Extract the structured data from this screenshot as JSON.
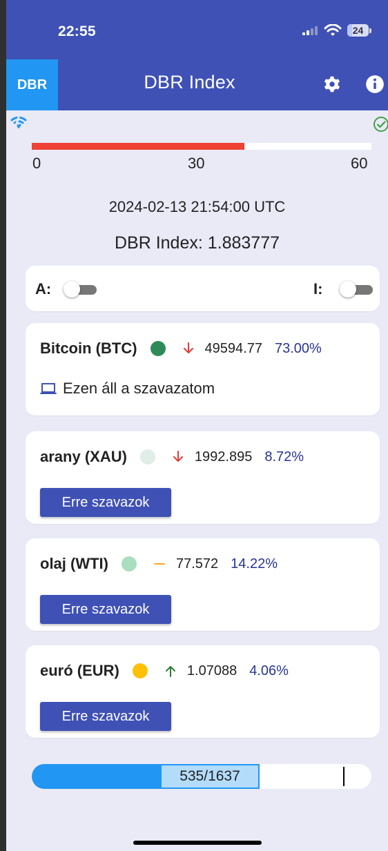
{
  "status_bar": {
    "time": "22:55",
    "battery": "24",
    "battery_fraction": 0.24
  },
  "app_bar": {
    "logo": "DBR",
    "title": "DBR Index",
    "settings_icon": "gear-icon",
    "info_icon": "info-icon"
  },
  "timer": {
    "wifi_icon": "wifi-icon",
    "status_icon": "check-circle-icon",
    "progress_fraction": 0.625,
    "ticks": [
      "0",
      "30",
      "60"
    ]
  },
  "summary": {
    "timestamp": "2024-02-13 21:54:00 UTC",
    "index": "DBR Index: 1.883777"
  },
  "toggles": {
    "a_label": "A:",
    "i_label": "I:",
    "a_on": false,
    "i_on": false
  },
  "assets": [
    {
      "name": "Bitcoin (BTC)",
      "dot_color": "#2e8b57",
      "trend": "down",
      "trend_color": "#e53935",
      "value": "49594.77",
      "percent": "73.00%",
      "vote_status": "Ezen áll a szavazatom",
      "vote_icon": "laptop-icon"
    },
    {
      "name": "arany (XAU)",
      "dot_color": "#dfeee6",
      "trend": "down",
      "trend_color": "#e53935",
      "value": "1992.895",
      "percent": "8.72%",
      "button": "Erre szavazok"
    },
    {
      "name": "olaj (WTI)",
      "dot_color": "#a9dfbf",
      "trend": "flat",
      "trend_color": "#ffa726",
      "value": "77.572",
      "percent": "14.22%",
      "button": "Erre szavazok"
    },
    {
      "name": "euró (EUR)",
      "dot_color": "#ffc107",
      "trend": "up",
      "trend_color": "#2e7d32",
      "value": "1.07088",
      "percent": "4.06%",
      "button": "Erre szavazok"
    }
  ],
  "footer": {
    "count": "535/1637",
    "fill_fraction": 0.67
  },
  "colors": {
    "primary": "#3f51b5",
    "accent": "#2196f3",
    "background": "#e9eaf6",
    "danger": "#ef4136"
  }
}
